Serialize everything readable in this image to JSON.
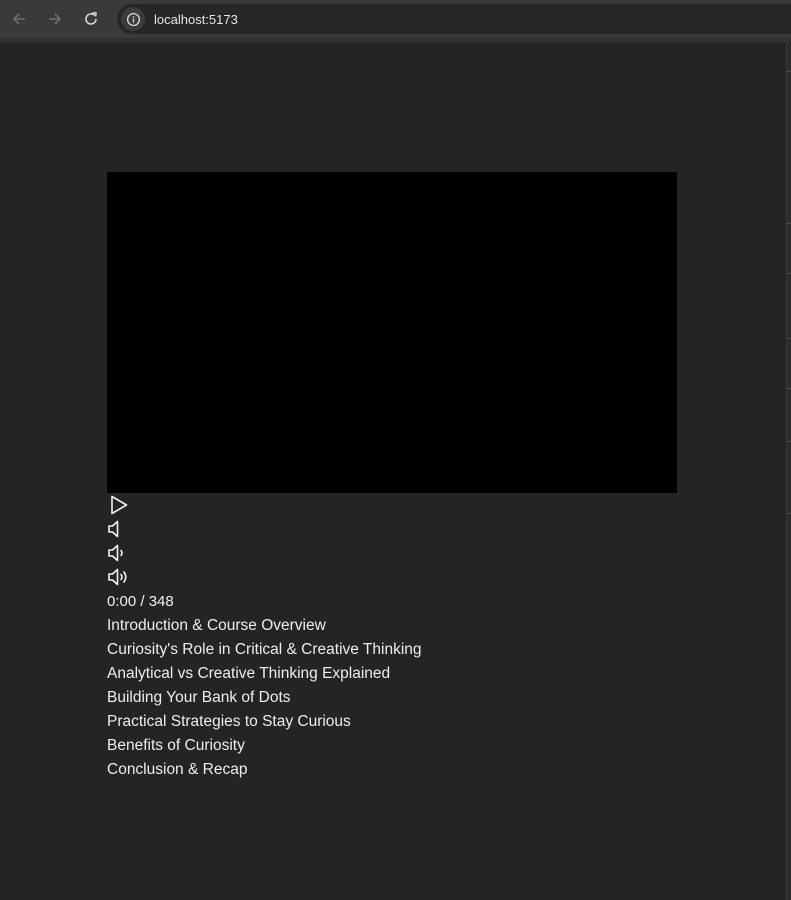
{
  "browser": {
    "url": "localhost:5173",
    "icons": [
      "back-icon",
      "forward-icon",
      "reload-icon",
      "info-icon"
    ]
  },
  "player": {
    "controls": {
      "play_icon": "play-icon",
      "mute_icon": "volume-mute-icon",
      "volume_low_icon": "volume-low-icon",
      "volume_high_icon": "volume-high-icon"
    },
    "time_display": "0:00 / 348"
  },
  "chapters": [
    "Introduction & Course Overview",
    "Curiosity's Role in Critical & Creative Thinking",
    "Analytical vs Creative Thinking Explained",
    "Building Your Bank of Dots",
    "Practical Strategies to Stay Curious",
    "Benefits of Curiosity",
    "Conclusion & Recap"
  ]
}
